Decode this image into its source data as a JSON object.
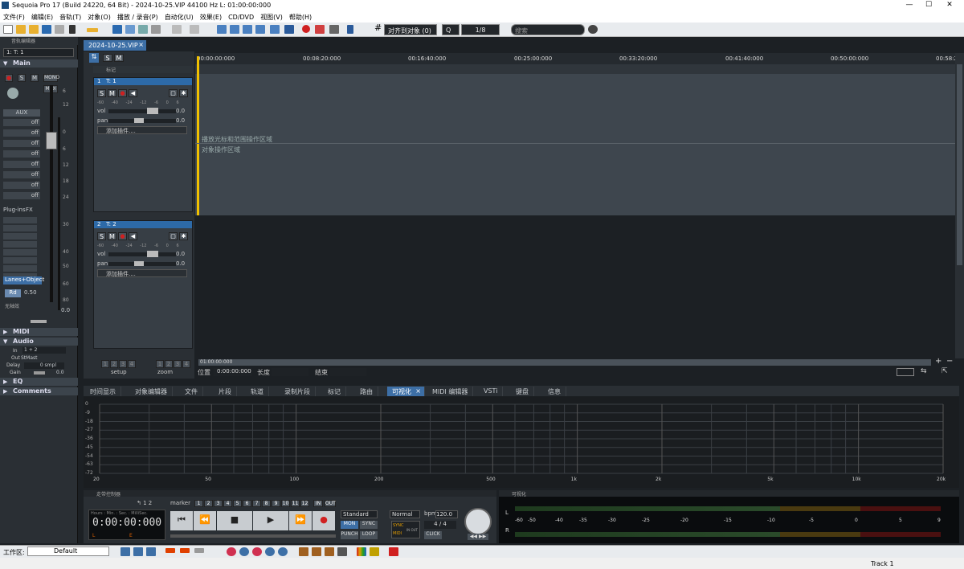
{
  "window": {
    "title": "Sequoia Pro 17 (Build 24220, 64 Bit)  -  2024-10-25.VIP   44100 Hz L: 01:00:00:000",
    "minimize": "—",
    "maximize": "☐",
    "close": "✕"
  },
  "menu": [
    "文件(F)",
    "编辑(E)",
    "音轨(T)",
    "对象(O)",
    "播放 / 录音(P)",
    "自动化(U)",
    "效果(E)",
    "CD/DVD",
    "视图(V)",
    "帮助(H)"
  ],
  "toolbar": {
    "snap_label": "对齐到对象 (0)",
    "zoom_label": "Q",
    "page_label": "1/8",
    "search_placeholder": "搜索"
  },
  "left_panel": {
    "title": "音轨编辑器",
    "track_select": "1: T: 1",
    "main_label": "Main",
    "rec": "●",
    "solo": "S",
    "mute": "M",
    "mono": "MONO",
    "midi": "MIDI",
    "aux_label": "AUX",
    "aux_values": [
      "off",
      "off",
      "off",
      "off",
      "off",
      "off",
      "off",
      "off"
    ],
    "plugins_label": "Plug-ins",
    "fx_label": "FX",
    "lanes_label": "Lanes+Object",
    "rd_label": "Rd",
    "rd_value": "0.50",
    "no_label": "无轴效",
    "fader_value": "0.0",
    "db_ticks": [
      "6",
      "12",
      "0",
      "6",
      "12",
      "18",
      "24",
      "30",
      "40",
      "50",
      "60",
      "80"
    ],
    "midi_section": "MIDI",
    "audio_section": "Audio",
    "in_label": "In",
    "in_value": "1 + 2",
    "out_label": "Out",
    "out_value": "StMast",
    "delay_label": "Delay",
    "delay_value": "0 smpl",
    "gain_label": "Gain",
    "gain_value": "0.0",
    "eq_section": "EQ",
    "comments_section": "Comments"
  },
  "project_tab": "2024-10-25.VIP",
  "track_panel": {
    "solo_all": "S",
    "mute_all": "M",
    "marker_label": "标记",
    "tracks": [
      {
        "num": "1",
        "name": "T: 1",
        "vol_label": "vol",
        "vol_value": "0.0",
        "pan_label": "pan",
        "pan_value": "0.0",
        "plugin_label": "添加插件....",
        "scale": [
          "-60",
          "-40",
          "-24",
          "-12",
          "-6",
          "0",
          "6"
        ]
      },
      {
        "num": "2",
        "name": "T: 2",
        "vol_label": "vol",
        "vol_value": "0.0",
        "pan_label": "pan",
        "pan_value": "0.0",
        "plugin_label": "添加插件....",
        "scale": [
          "-60",
          "-40",
          "-24",
          "-12",
          "-6",
          "0",
          "6"
        ]
      }
    ],
    "setup_label": "setup",
    "zoom_label": "zoom",
    "setup_buttons": [
      "1",
      "2",
      "3",
      "4"
    ],
    "zoom_buttons": [
      "1",
      "2",
      "3",
      "4"
    ]
  },
  "arranger": {
    "ruler": [
      "00:00:00:000",
      "00:08:20:000",
      "00:16:40:000",
      "00:25:00:000",
      "00:33:20:000",
      "00:41:40:000",
      "00:50:00:000",
      "00:58:2"
    ],
    "hint_playcursor": "播放光标和范围操作区域",
    "hint_object": "对象操作区域",
    "timeline_end": "01:00:00:000",
    "pos_label": "位置",
    "pos_value": "0:00:00:000",
    "length_label": "长度",
    "end_label": "结束"
  },
  "tabs": [
    {
      "label": "时间显示",
      "active": false
    },
    {
      "label": "对象编辑器",
      "active": false
    },
    {
      "label": "文件",
      "active": false
    },
    {
      "label": "片段",
      "active": false
    },
    {
      "label": "轨道",
      "active": false
    },
    {
      "label": "录制片段",
      "active": false
    },
    {
      "label": "标记",
      "active": false
    },
    {
      "label": "路由",
      "active": false
    },
    {
      "label": "可视化",
      "active": true
    },
    {
      "label": "MIDI 编辑器",
      "active": false
    },
    {
      "label": "VSTi",
      "active": false
    },
    {
      "label": "键盘",
      "active": false
    },
    {
      "label": "信息",
      "active": false
    }
  ],
  "spectrum": {
    "y_ticks": [
      "0",
      "-9",
      "-18",
      "-27",
      "-36",
      "-45",
      "-54",
      "-63",
      "-72"
    ],
    "x_ticks": [
      "20",
      "50",
      "100",
      "200",
      "500",
      "1k",
      "2k",
      "5k",
      "10k",
      "20k"
    ]
  },
  "transport": {
    "title": "走带控制器",
    "marker_label": "marker",
    "marker_nums": [
      "1",
      "2",
      "3",
      "4",
      "5",
      "6",
      "7",
      "8",
      "9",
      "10",
      "11",
      "12"
    ],
    "in_label": "IN",
    "out_label": "OUT",
    "time_header": "Hours : Min. : Sec. : MilliSec.",
    "time": "0:00:00:000",
    "l_label": "L",
    "e_label": "E",
    "standard": "Standard",
    "normal": "Normal",
    "bpm_label": "bpm",
    "bpm_value": "120.0",
    "sig": "4 / 4",
    "mon": "MON",
    "sync": "SYNC",
    "punch": "PUNCH",
    "loop": "LOOP",
    "sync2": "SYNC",
    "midi": "MIDI",
    "in_out": "IN OUT",
    "click": "CLICK"
  },
  "vu": {
    "title": "可视化",
    "l": "L",
    "r": "R",
    "scale": [
      "-60",
      "-50",
      "-40",
      "-35",
      "-30",
      "-25",
      "-20",
      "-15",
      "-10",
      "-5",
      "0",
      "5",
      "9"
    ]
  },
  "workspace": {
    "label": "工作区:",
    "value": "Default"
  },
  "status": {
    "right": "Track 1"
  }
}
